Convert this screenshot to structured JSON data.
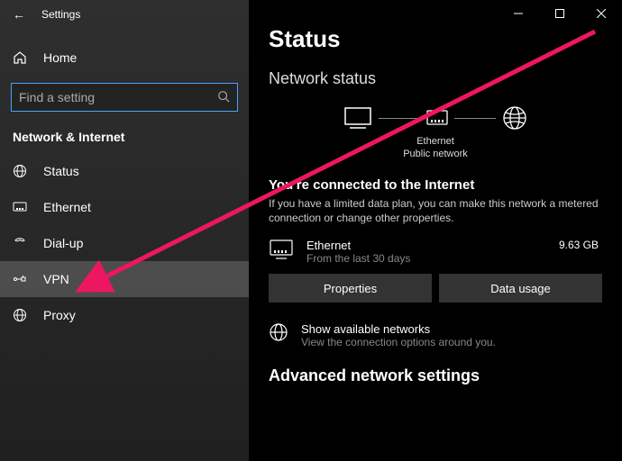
{
  "titlebar": {
    "title": "Settings"
  },
  "home_label": "Home",
  "search": {
    "placeholder": "Find a setting"
  },
  "section_header": "Network & Internet",
  "nav": [
    {
      "id": "status",
      "label": "Status",
      "selected": false
    },
    {
      "id": "ethernet",
      "label": "Ethernet",
      "selected": false
    },
    {
      "id": "dialup",
      "label": "Dial-up",
      "selected": false
    },
    {
      "id": "vpn",
      "label": "VPN",
      "selected": true
    },
    {
      "id": "proxy",
      "label": "Proxy",
      "selected": false
    }
  ],
  "main": {
    "page_title": "Status",
    "subtitle": "Network status",
    "diagram": {
      "adapter": "Ethernet",
      "profile": "Public network"
    },
    "connected_heading": "You're connected to the Internet",
    "connected_desc": "If you have a limited data plan, you can make this network a metered connection or change other properties.",
    "connection": {
      "name": "Ethernet",
      "period": "From the last 30 days",
      "usage": "9.63 GB"
    },
    "buttons": {
      "properties": "Properties",
      "data_usage": "Data usage"
    },
    "available": {
      "title": "Show available networks",
      "sub": "View the connection options around you."
    },
    "advanced_heading": "Advanced network settings"
  }
}
